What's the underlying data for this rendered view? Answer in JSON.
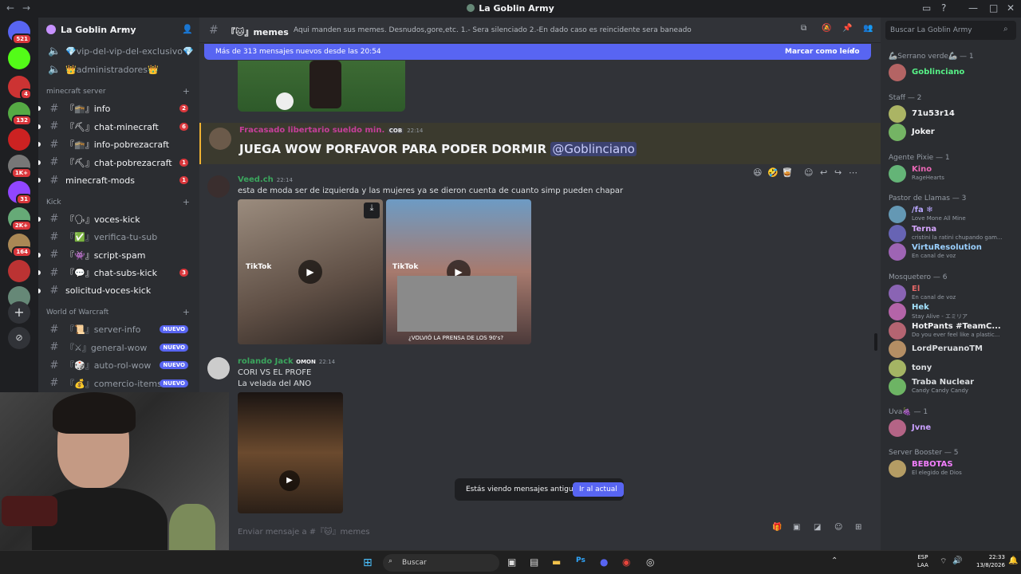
{
  "window": {
    "title": "La Goblin Army",
    "back": "←",
    "forward": "→"
  },
  "servers": [
    {
      "name": "discord-home",
      "badge": "521",
      "color": "#5865f2"
    },
    {
      "name": "kick",
      "badge": "",
      "color": "#53fc18"
    },
    {
      "name": "server-red",
      "badge": "4",
      "color": "#c33"
    },
    {
      "name": "server-3",
      "badge": "132",
      "color": "#5a4"
    },
    {
      "name": "server-4",
      "badge": "",
      "color": "#c22"
    },
    {
      "name": "server-5",
      "badge": "1K+",
      "color": "#777"
    },
    {
      "name": "twitch",
      "badge": "31",
      "color": "#9146ff"
    },
    {
      "name": "server-7",
      "badge": "2K+",
      "color": "#6a7"
    },
    {
      "name": "server-8",
      "badge": "164",
      "color": "#a85"
    },
    {
      "name": "server-9",
      "badge": "",
      "color": "#b33"
    },
    {
      "name": "goblin",
      "badge": "",
      "color": "#687"
    }
  ],
  "channels": {
    "server_name": "La Goblin Army",
    "top": [
      {
        "label": "💎vip-del-vip-del-exclusivo💎"
      },
      {
        "label": "👑administradores👑"
      }
    ],
    "categories": [
      {
        "name": "minecraft server",
        "items": [
          {
            "label": "『🕋』info",
            "count": "2",
            "unread": true
          },
          {
            "label": "『⛏』chat-minecraft",
            "count": "6",
            "unread": true
          },
          {
            "label": "『🕋』info-pobrezacraft",
            "count": "",
            "unread": true
          },
          {
            "label": "『⛏』chat-pobrezacraft",
            "count": "1",
            "unread": true
          },
          {
            "label": "minecraft-mods",
            "count": "1",
            "unread": true
          }
        ]
      },
      {
        "name": "Kick",
        "items": [
          {
            "label": "『🗣』voces-kick",
            "count": "",
            "unread": true
          },
          {
            "label": "『✅』verifica-tu-sub",
            "count": "",
            "unread": false
          },
          {
            "label": "『👾』script-spam",
            "count": "",
            "unread": true
          },
          {
            "label": "『💬』chat-subs-kick",
            "count": "3",
            "unread": true
          },
          {
            "label": "solicitud-voces-kick",
            "count": "",
            "unread": true
          }
        ]
      },
      {
        "name": "World of Warcraft",
        "items": [
          {
            "label": "『📜』server-info",
            "new": "NUEVO"
          },
          {
            "label": "『⚔』general-wow",
            "new": "NUEVO"
          },
          {
            "label": "『🎲』auto-rol-wow",
            "new": "NUEVO"
          },
          {
            "label": "『💰』comercio-items",
            "new": "NUEVO"
          }
        ]
      }
    ]
  },
  "header": {
    "channel": "『🐱』memes",
    "topic": "Aqui manden sus memes. Desnudos,gore,etc. 1.- Sera silenciado 2.-En dado caso es reincidente sera baneado",
    "search_placeholder": "Buscar La Goblin Army"
  },
  "newbar": {
    "text": "Más de 313 mensajes nuevos desde las 20:54",
    "action": "Marcar como leído"
  },
  "messages": [
    {
      "user": "Fracasado libertario sueldo min.",
      "tag": "COB",
      "time": "22:14",
      "text": "JUEGA WOW PORFAVOR PARA PODER DORMIR",
      "mention": "@Goblinciano",
      "color": "#c63f9a"
    },
    {
      "user": "Veed.ch",
      "time": "22:14",
      "text": "esta de moda ser de izquierda y las mujeres ya se dieron cuenta de cuanto simp pueden chapar",
      "color": "#3ba55d",
      "tiktok1": "TikTok",
      "tiktok2": "TikTok",
      "caption": "¿VOLVIÓ LA PRENSA DE LOS 90's?"
    },
    {
      "user": "rolando Jack",
      "tag": "OMON",
      "time": "22:14",
      "line1": "CORI VS EL PROFE",
      "line2": "La velada del ANO",
      "color": "#3ba55d"
    }
  ],
  "old_banner": {
    "text": "Estás viendo mensajes antiguos",
    "button": "Ir al actual"
  },
  "composer": {
    "placeholder": "Enviar mensaje a #『🐱』memes"
  },
  "members": {
    "groups": [
      {
        "title": "🦾Serrano verde🦾 — 1",
        "members": [
          {
            "name": "Goblinciano",
            "status": "",
            "color": "#57f287"
          }
        ]
      },
      {
        "title": "Staff — 2",
        "members": [
          {
            "name": "71u53r14",
            "status": "",
            "color": "#f2f3f5"
          },
          {
            "name": "Joker",
            "status": "",
            "color": "#f2f3f5"
          }
        ]
      },
      {
        "title": "Agente Pixie — 1",
        "members": [
          {
            "name": "Kino",
            "status": "RageHearts",
            "color": "#e967b5"
          }
        ]
      },
      {
        "title": "Pastor de Llamas — 3",
        "members": [
          {
            "name": "/fa ❄",
            "status": "Love Mone All Mine",
            "color": "#b9a7ff"
          },
          {
            "name": "Terna",
            "status": "cristini la ratini chupando gam...",
            "color": "#d7a7ff"
          },
          {
            "name": "VirtuResolution",
            "status": "En canal de voz",
            "color": "#9ad0ff"
          }
        ]
      },
      {
        "title": "Mosquetero — 6",
        "members": [
          {
            "name": "El",
            "status": "En canal de voz",
            "color": "#e06666"
          },
          {
            "name": "Hek",
            "status": "Stay Alive - エミリア",
            "color": "#a4e3ff"
          },
          {
            "name": "HotPants #TeamC...",
            "status": "Do you ever feel like a plastic...",
            "color": "#f2f3f5"
          },
          {
            "name": "LordPeruanoTM",
            "status": "",
            "color": "#dbdee1"
          },
          {
            "name": "tony",
            "status": "",
            "color": "#dbdee1"
          },
          {
            "name": "Traba Nuclear",
            "status": "Candy Candy Candy",
            "color": "#dbdee1"
          }
        ]
      },
      {
        "title": "Uva🍇 — 1",
        "members": [
          {
            "name": "Jvne",
            "status": "",
            "color": "#c9a0ff"
          }
        ]
      },
      {
        "title": "Server Booster — 5",
        "members": [
          {
            "name": "BEBOTAS",
            "status": "El elegido de Dios",
            "color": "#f47fff"
          }
        ]
      }
    ]
  },
  "taskbar": {
    "search": "Buscar",
    "lang1": "ESP",
    "lang2": "LAA",
    "time": "22:33",
    "date": "13/8/2026"
  },
  "colors": {
    "accent": "#5865f2",
    "bg": "#313338",
    "sidebar": "#2b2d31",
    "rail": "#1e1f22"
  }
}
